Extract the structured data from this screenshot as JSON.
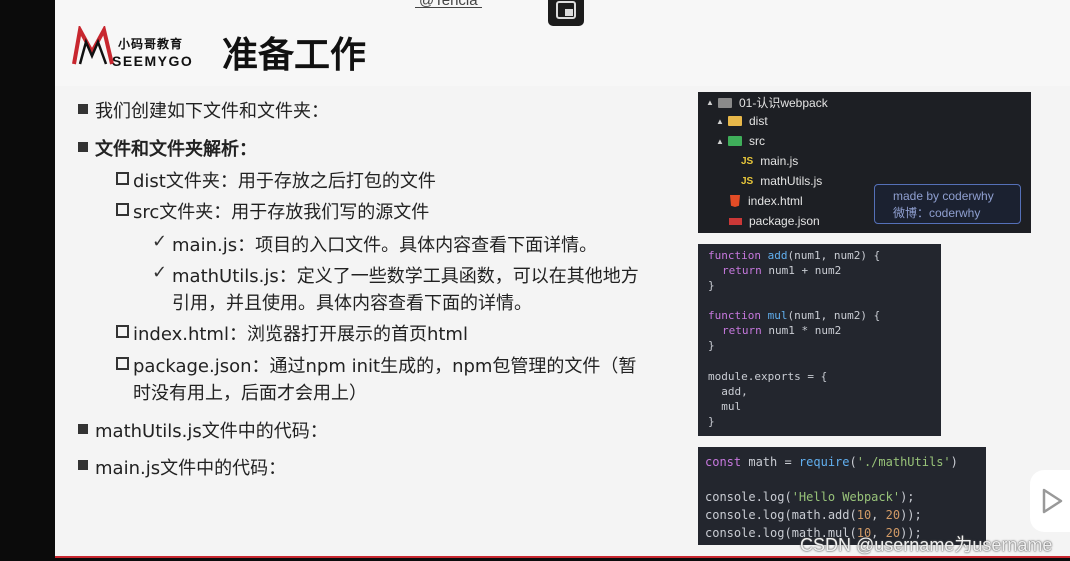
{
  "overlay": {
    "top_title": "@Tencia",
    "pip_icon": "picture-in-picture-icon",
    "watermark_bottom": "CSDN @username为username",
    "play_icon": "play-icon"
  },
  "logo": {
    "top_text": "小码哥教育",
    "bottom_text": "SEEMYGO"
  },
  "title": "准备工作",
  "content": {
    "l1": "我们创建如下文件和文件夹：",
    "l2": "文件和文件夹解析：",
    "l3": "dist文件夹：用于存放之后打包的文件",
    "l4": "src文件夹：用于存放我们写的源文件",
    "l5": "main.js：项目的入口文件。具体内容查看下面详情。",
    "l6a": "mathUtils.js：定义了一些数学工具函数，可以在其他地方",
    "l6b": "引用，并且使用。具体内容查看下面的详情。",
    "l7": "index.html：浏览器打开展示的首页html",
    "l8a": "package.json：通过npm init生成的，npm包管理的文件（暂",
    "l8b": "时没有用上，后面才会用上）",
    "l9": "mathUtils.js文件中的代码：",
    "l10": "main.js文件中的代码：",
    "check_symbol": "✓"
  },
  "tree": {
    "root": "01-认识webpack",
    "dist": "dist",
    "src": "src",
    "main": "main.js",
    "mathutils": "mathUtils.js",
    "index": "index.html",
    "package": "package.json",
    "js_badge": "JS",
    "badge_line1": "made by coderwhy",
    "badge_line2": "微博：coderwhy",
    "colors": {
      "dist_folder": "#e8b84a",
      "src_folder": "#3fae5a"
    }
  },
  "code1": {
    "f1": "function",
    "add": "add",
    "f1_args": "(num1, num2) {",
    "ret": "return",
    "body_add": " num1 + num2",
    "close": "}",
    "mul": "mul",
    "body_mul": " num1 * num2",
    "exports": "module.exports = {",
    "exp_add": "  add,",
    "exp_mul": "  mul"
  },
  "code2": {
    "const": "const",
    "decl": " math = ",
    "require": "require",
    "paren_open": "(",
    "path": "'./mathUtils'",
    "paren_close": ")",
    "log1_pre": "console.log(",
    "hello": "'Hello Webpack'",
    "log1_post": ");",
    "log2_pre": "console.log(math.add(",
    "n10": "10",
    "comma": ", ",
    "n20": "20",
    "log2_post": "));",
    "log3_pre": "console.log(math.mul(",
    "log3_post": "));"
  }
}
